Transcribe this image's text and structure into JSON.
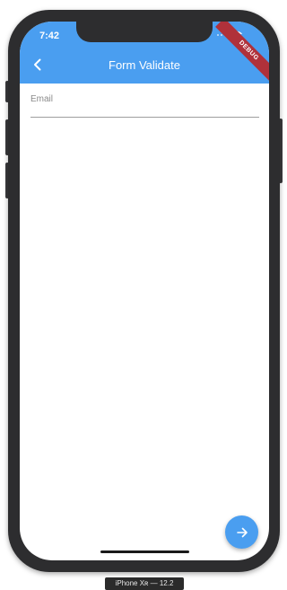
{
  "status_bar": {
    "time": "7:42"
  },
  "debug_banner": {
    "text": "DEBUG"
  },
  "app_bar": {
    "title": "Form Validate",
    "back_icon": "chevron-left-icon",
    "color": "#4a9ef0"
  },
  "form": {
    "email": {
      "label": "Email",
      "value": ""
    }
  },
  "fab": {
    "icon": "arrow-right-icon",
    "color": "#4a9ef0"
  },
  "device": {
    "label": "iPhone Xʀ — 12.2"
  }
}
